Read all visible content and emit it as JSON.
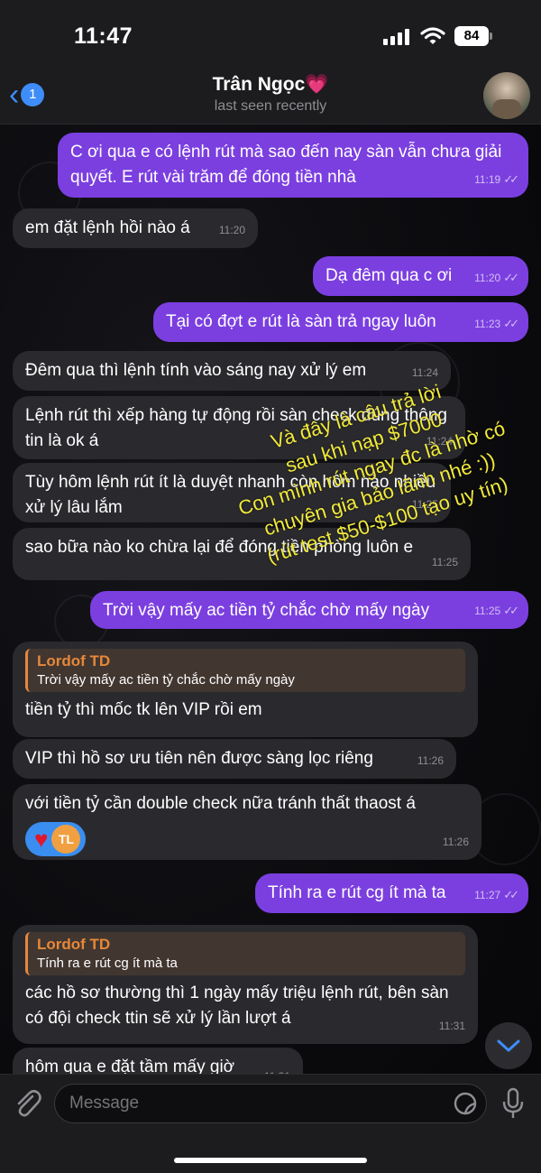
{
  "status": {
    "time": "11:47",
    "battery": "84"
  },
  "header": {
    "back_badge": "1",
    "contact_name": "Trân Ngọc",
    "heart": "💗",
    "status": "last seen recently"
  },
  "messages": [
    {
      "dir": "out",
      "text": "C ơi qua e có lệnh rút mà sao đến nay sàn vẫn chưa giải quyết. E rút vài trăm để đóng tiền nhà",
      "time": "11:19"
    },
    {
      "dir": "in",
      "text": "em đặt lệnh hồi nào á",
      "time": "11:20"
    },
    {
      "dir": "out",
      "text": "Dạ đêm qua c ơi",
      "time": "11:20"
    },
    {
      "dir": "out",
      "text": "Tại có đợt e rút là sàn trả ngay luôn",
      "time": "11:23"
    },
    {
      "dir": "in",
      "text": "Đêm qua thì lệnh tính vào sáng nay xử lý em",
      "time": "11:24"
    },
    {
      "dir": "in",
      "text": "Lệnh rút thì xếp hàng tự động rồi sàn check đúng thông tin là ok á",
      "time": "11:24"
    },
    {
      "dir": "in",
      "text": "Tùy hôm lệnh rút ít là duyệt nhanh còn hôm nào nhiều xử lý lâu lắm",
      "time": "11:25"
    },
    {
      "dir": "in",
      "text": "sao bữa nào ko chừa lại để đóng tiền phòng luôn e",
      "time": "11:25"
    },
    {
      "dir": "out",
      "text": "Trời vậy mấy ac tiền tỷ chắc chờ mấy ngày",
      "time": "11:25"
    },
    {
      "dir": "in",
      "reply_name": "Lordof TD",
      "reply_text": "Trời vậy mấy ac tiền tỷ chắc chờ mấy ngày",
      "text": "tiền tỷ thì mốc tk lên VIP rồi em",
      "time": "11:26"
    },
    {
      "dir": "in",
      "text": "VIP thì hồ sơ ưu tiên nên được sàng lọc riêng",
      "time": "11:26"
    },
    {
      "dir": "in",
      "text": "với tiền tỷ cần double check nữa tránh thất thaost á",
      "time": "11:26",
      "reaction_initials": "TL"
    },
    {
      "dir": "out",
      "text": "Tính ra e rút cg ít mà ta",
      "time": "11:27"
    },
    {
      "dir": "in",
      "reply_name": "Lordof TD",
      "reply_text": "Tính ra e rút cg ít mà ta",
      "text": "các hồ sơ thường thì 1 ngày mấy triệu lệnh rút, bên sàn có đội check ttin sẽ xử lý lần lượt á",
      "time": "11:31"
    },
    {
      "dir": "in",
      "text": "hôm qua e đặt tầm mấy giờ",
      "time": "11:31"
    }
  ],
  "overlay_note": [
    "Và đây là câu trả lời",
    "sau khi nạp $7000",
    "Con mình rút ngay đc là nhờ có",
    "chuyên gia bảo lãnh nhé :))",
    "(rút test $50-$100 tạo uy tín)"
  ],
  "input": {
    "placeholder": "Message"
  },
  "colors": {
    "outgoing": "#7b3fe0",
    "incoming": "#2a2a2e",
    "accent": "#3e8df8",
    "reply": "#e6883a",
    "note": "#f2ea3a"
  },
  "icons": [
    "back-chevron-icon",
    "paperclip-icon",
    "sticker-icon",
    "microphone-icon",
    "scroll-down-icon",
    "wifi-icon",
    "signal-icon",
    "battery-icon"
  ]
}
